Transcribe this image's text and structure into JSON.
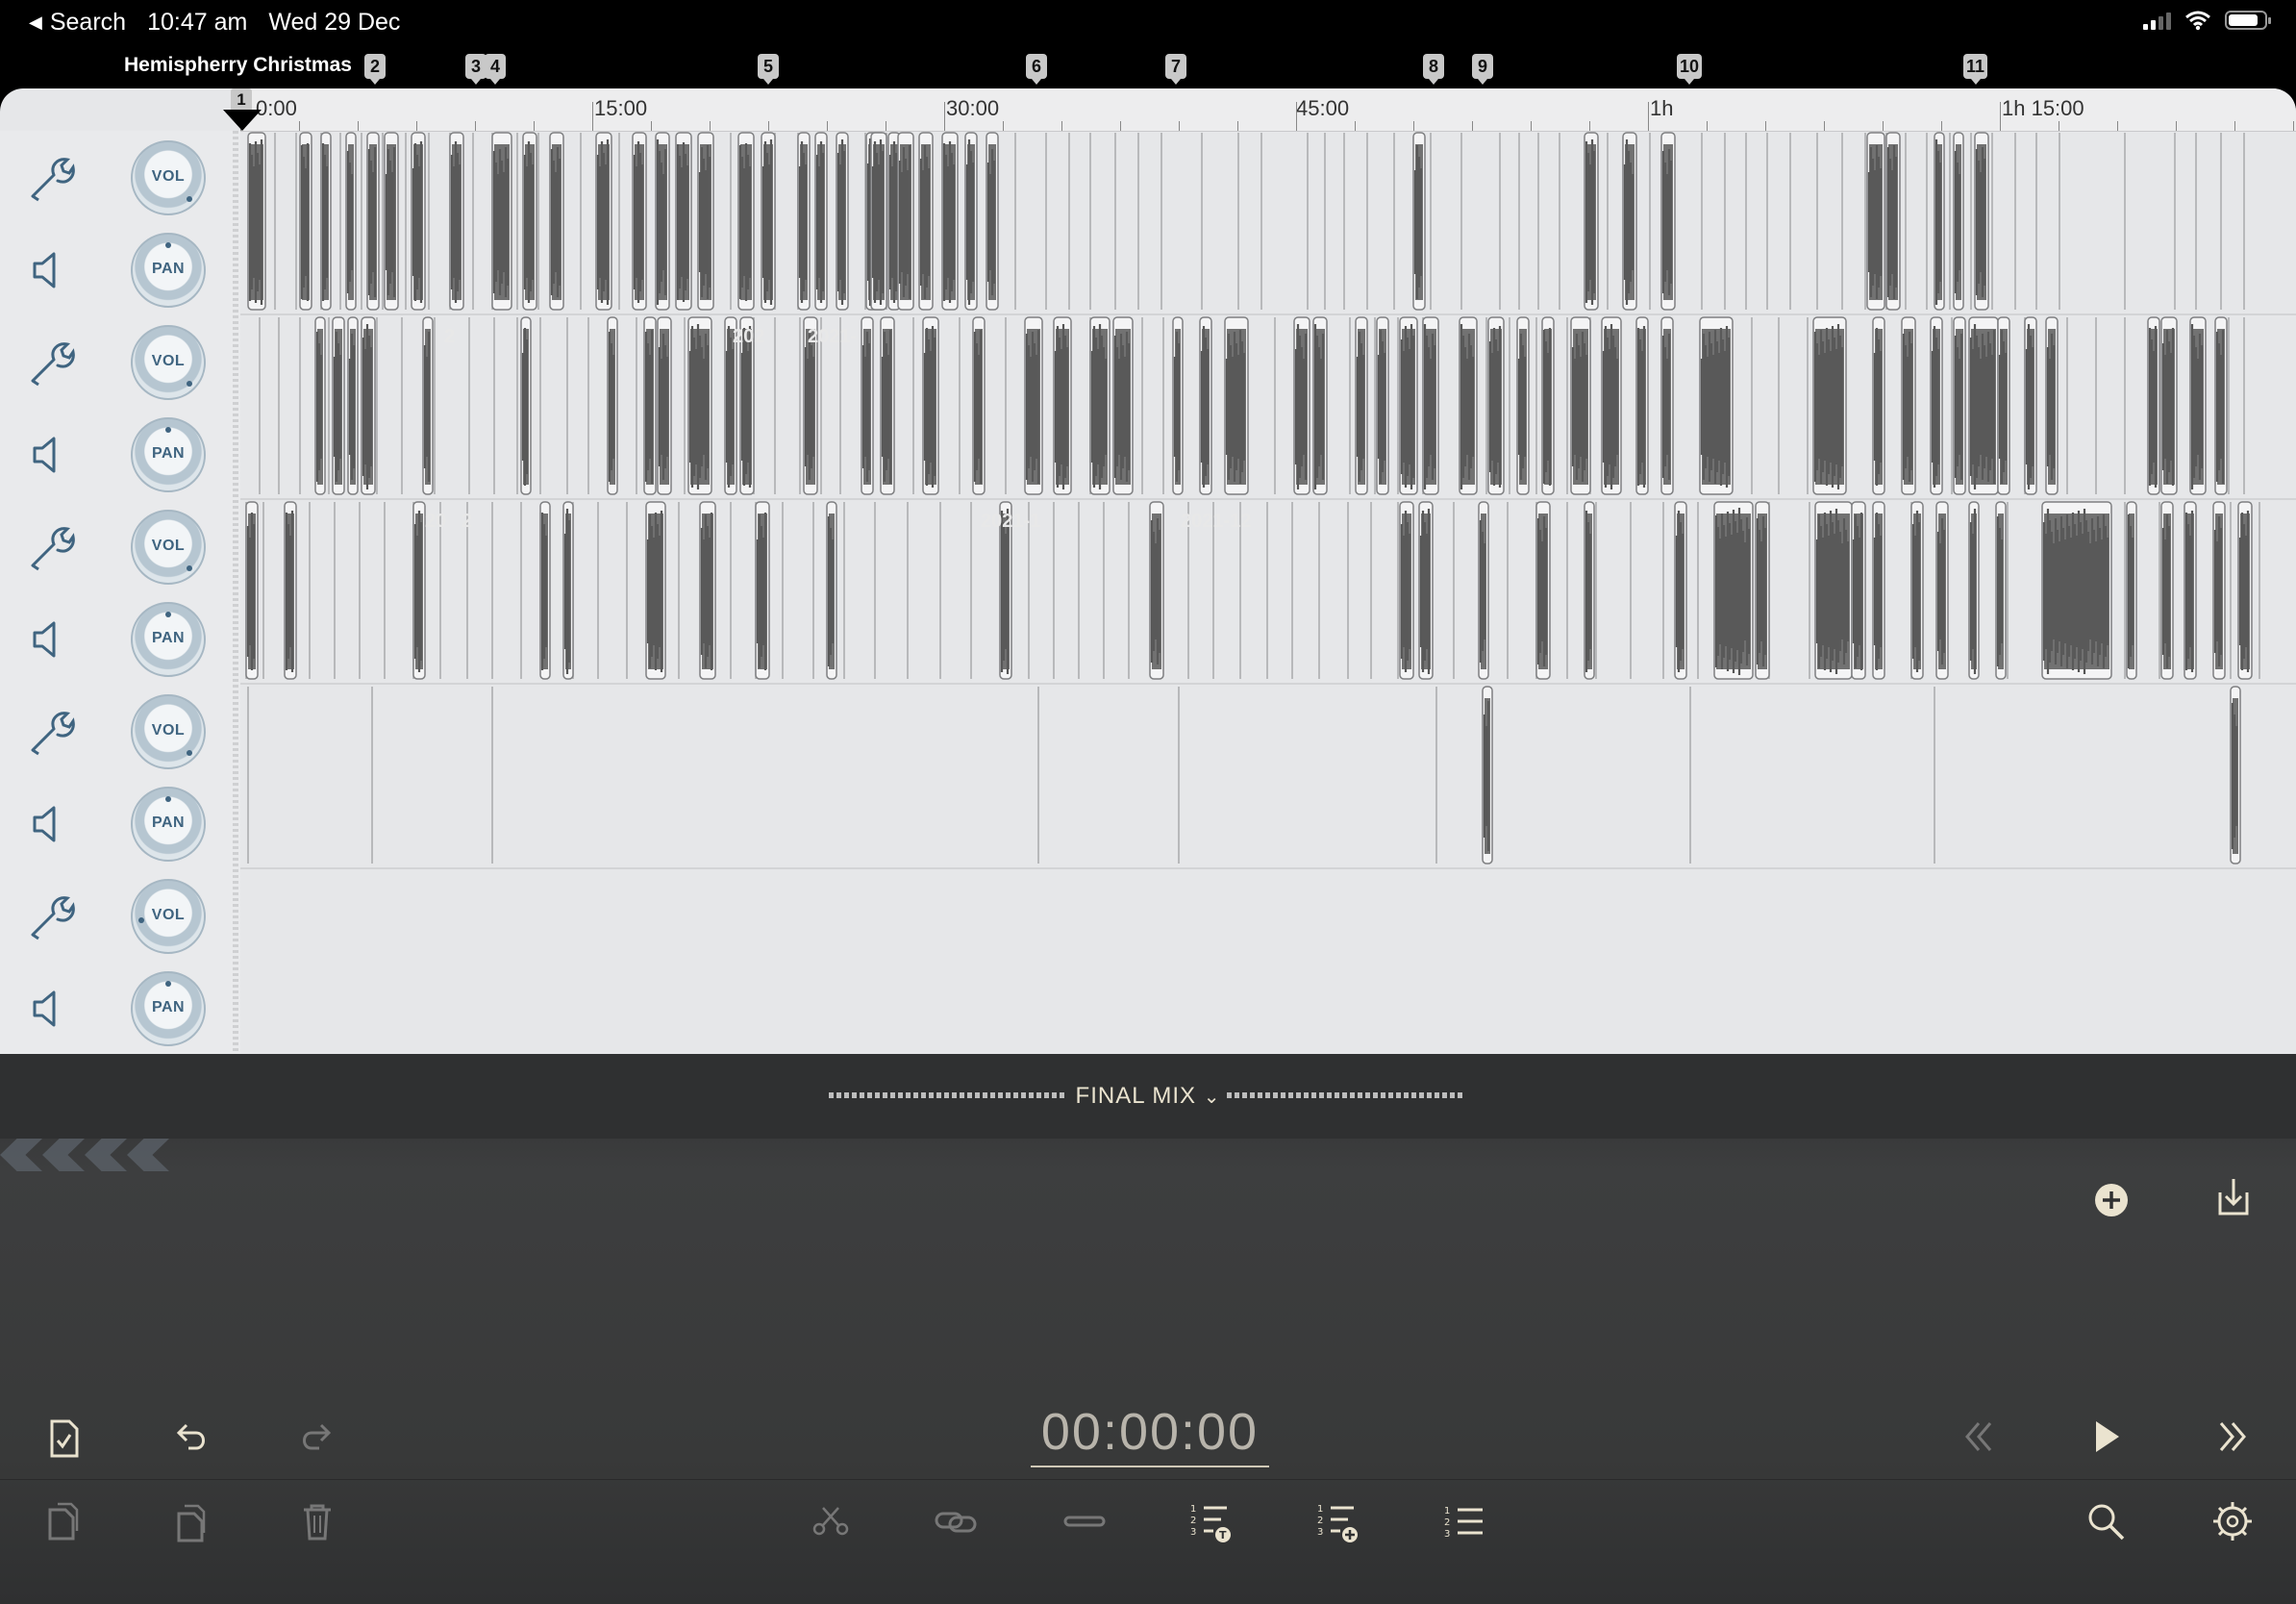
{
  "status_bar": {
    "back_label": "Search",
    "time": "10:47 am",
    "date": "Wed 29 Dec"
  },
  "project": {
    "title": "Hemispherry Christmas",
    "markers": [
      "1",
      "2",
      "3",
      "4",
      "5",
      "6",
      "7",
      "8",
      "9",
      "10",
      "11"
    ]
  },
  "ruler": {
    "labels": [
      "0:00",
      "15:00",
      "30:00",
      "45:00",
      "1h",
      "1h 15:00"
    ]
  },
  "tracks": [
    {
      "volume_label": "VOL",
      "pan_label": "PAN",
      "clip_labels": []
    },
    {
      "volume_label": "VOL",
      "pan_label": "PAN",
      "clip_labels": [
        "2",
        "202",
        "2021-"
      ]
    },
    {
      "volume_label": "VOL",
      "pan_label": "PAN",
      "clip_labels": [
        "20",
        "2",
        "2021-1",
        "2021-12"
      ]
    },
    {
      "volume_label": "VOL",
      "pan_label": "PAN",
      "clip_labels": []
    },
    {
      "volume_label": "VOL",
      "pan_label": "PAN",
      "clip_labels": []
    }
  ],
  "mixer": {
    "title": "FINAL MIX",
    "timecode": "00:00:00"
  },
  "icons": {
    "add": "add-circle-icon",
    "export": "export-icon",
    "document": "document-check-icon",
    "undo": "undo-icon",
    "redo": "redo-icon",
    "rewind": "rewind-icon",
    "play": "play-icon",
    "fast_forward": "fast-forward-icon",
    "cut": "scissors-icon",
    "link": "link-icon",
    "unlink": "unlink-icon",
    "list_text": "list-text-icon",
    "list_add": "list-add-icon",
    "list": "numbered-list-icon",
    "search": "search-icon",
    "settings": "gear-icon",
    "copy": "copy-icon",
    "paste": "paste-icon",
    "delete": "trash-icon"
  },
  "colors": {
    "accent": "#eae3cf",
    "knob": "#3f6480",
    "waveform": "#555555",
    "panel": "#e6e7e9"
  }
}
